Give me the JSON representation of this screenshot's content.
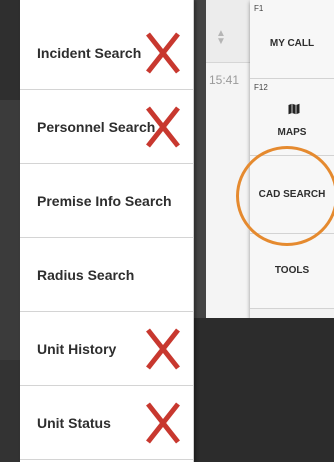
{
  "menu": {
    "items": [
      {
        "label": "Incident Search",
        "crossed": true
      },
      {
        "label": "Personnel Search",
        "crossed": true
      },
      {
        "label": "Premise Info Search",
        "crossed": false
      },
      {
        "label": "Radius Search",
        "crossed": false
      },
      {
        "label": "Unit History",
        "crossed": true
      },
      {
        "label": "Unit Status",
        "crossed": true
      }
    ]
  },
  "table": {
    "time_fragment": "15:41"
  },
  "fkeys": [
    {
      "key": "F1",
      "label": "MY CALL"
    },
    {
      "key": "F12",
      "label": "MAPS",
      "icon": "map-icon"
    },
    {
      "key": "",
      "label": "CAD SEARCH",
      "highlighted": true
    },
    {
      "key": "",
      "label": "TOOLS"
    }
  ],
  "colors": {
    "x_mark": "#c8382f",
    "highlight_circle": "#e58a2f"
  }
}
